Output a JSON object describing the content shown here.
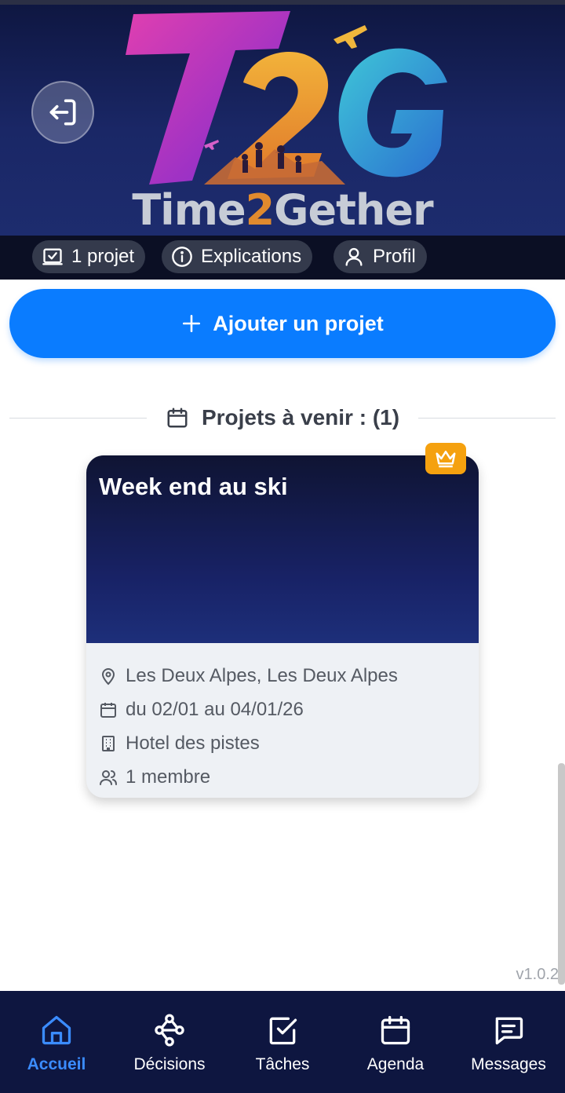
{
  "brand": {
    "logo_text": "T2G",
    "name_part1": "Time",
    "name_two": "2",
    "name_part2": "Gether"
  },
  "chips": [
    {
      "label": "1 projet",
      "icon": "checkbox-icon"
    },
    {
      "label": "Explications",
      "icon": "info-icon"
    },
    {
      "label": "Profil",
      "icon": "user-icon"
    }
  ],
  "add_button": {
    "label": "Ajouter un projet",
    "icon": "plus-icon"
  },
  "section": {
    "label": "Projets à venir : (1)",
    "icon": "calendar-icon"
  },
  "project": {
    "title": "Week end au ski",
    "location": "Les Deux Alpes, Les Deux Alpes",
    "dates": "du 02/01 au 04/01/26",
    "hotel": "Hotel des pistes",
    "members": "1 membre",
    "badge_icon": "crown-icon"
  },
  "version": "v1.0.2",
  "tabs": [
    {
      "label": "Accueil",
      "icon": "home-icon",
      "active": true
    },
    {
      "label": "Décisions",
      "icon": "flow-icon",
      "active": false
    },
    {
      "label": "Tâches",
      "icon": "task-check-icon",
      "active": false
    },
    {
      "label": "Agenda",
      "icon": "calendar-icon",
      "active": false
    },
    {
      "label": "Messages",
      "icon": "message-icon",
      "active": false
    }
  ],
  "colors": {
    "primary": "#0a7cff",
    "tab_active": "#3b8cff",
    "header_bg": "#0e1640",
    "badge": "#f5a10f"
  }
}
